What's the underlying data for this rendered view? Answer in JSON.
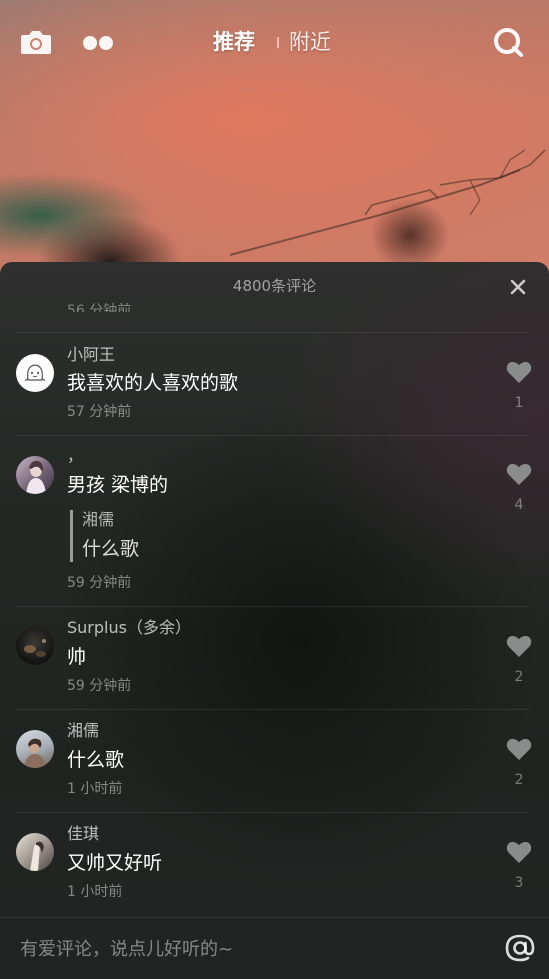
{
  "header": {
    "tabs": [
      {
        "label": "推荐",
        "active": true
      },
      {
        "label": "附近",
        "active": false
      }
    ],
    "icons": {
      "camera": "camera-icon",
      "dots": "dots-icon",
      "search": "search-icon"
    }
  },
  "comments_panel": {
    "title": "4800条评论",
    "close_icon": "close-icon",
    "cutoff_time": "56 分钟前",
    "comments": [
      {
        "username": "小阿王",
        "text": "我喜欢的人喜欢的歌",
        "time": "57 分钟前",
        "likes": "1"
      },
      {
        "username": "，",
        "text": "男孩 梁博的",
        "reply": {
          "username": "湘儒",
          "text": "什么歌"
        },
        "time": "59 分钟前",
        "likes": "4"
      },
      {
        "username": "Surplus（多余）",
        "text": "帅",
        "time": "59 分钟前",
        "likes": "2"
      },
      {
        "username": "湘儒",
        "text": "什么歌",
        "time": "1 小时前",
        "likes": "2"
      },
      {
        "username": "佳琪",
        "text": "又帅又好听",
        "time": "1 小时前",
        "likes": "3"
      }
    ]
  },
  "input": {
    "placeholder": "有爱评论，说点儿好听的~",
    "value": "",
    "mention_icon": "at-icon"
  },
  "colors": {
    "sheet_background": "#242825",
    "heart": "#8a8c8b",
    "text_primary": "#ffffff",
    "text_secondary": "#9b9d9c"
  }
}
